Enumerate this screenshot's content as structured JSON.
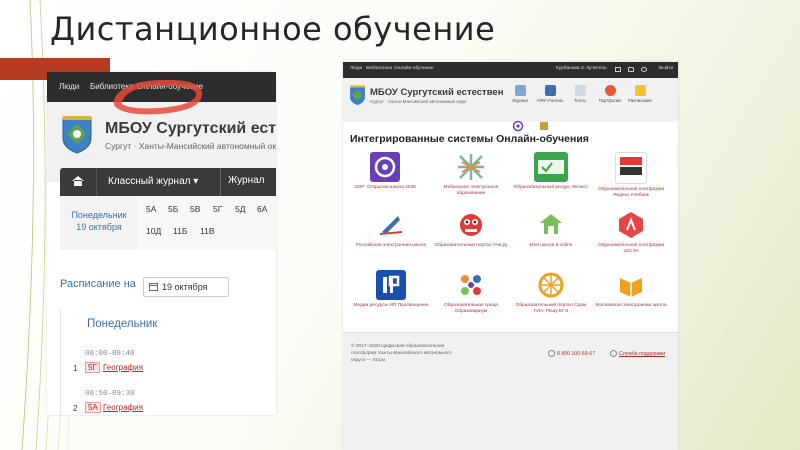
{
  "slide": {
    "title": "Дистанционное обучение"
  },
  "left_screenshot": {
    "nav": [
      "Люди",
      "Библиотека",
      "Онлайн-обучение"
    ],
    "school_title": "МБОУ Сургутский естественно",
    "school_subtitle": "Сургут · Ханты-Мансийский автономный округ",
    "journal_menu": "Классный журнал",
    "journal_next": "Журнал",
    "day": "Понедельник",
    "date": "19 октября",
    "classes_row1": [
      "5А",
      "5Б",
      "5В",
      "5Г",
      "5Д",
      "6А"
    ],
    "classes_row2": [
      "10Д",
      "11Б",
      "11В"
    ],
    "schedule_label": "Расписание на",
    "schedule_date": "19 октября",
    "card_day": "Понедельник",
    "lessons": [
      {
        "time": "08:00–08:40",
        "num": "1",
        "class": "5Г",
        "subject": "География"
      },
      {
        "time": "08:50–09:30",
        "num": "2",
        "class": "5А",
        "subject": "География"
      }
    ]
  },
  "right_screenshot": {
    "nav": [
      "Люди",
      "Библиотека",
      "Онлайн-обучение"
    ],
    "user": "Курбанова З. К.",
    "role": "учитель",
    "exit": "Выйти",
    "school_title": "МБОУ Сургутский естествен",
    "school_subtitle": "Сургут · Ханты-Мансийский автономный округ",
    "quick_items": [
      {
        "label": "Журнал",
        "color": "#7da7d9"
      },
      {
        "label": "АРМ Учитель",
        "color": "#3a6fae"
      },
      {
        "label": "Тесты",
        "color": "#cfd8e3"
      },
      {
        "label": "Портфолио",
        "color": "#e55a3a"
      },
      {
        "label": "Расписание",
        "color": "#f2c12e"
      }
    ],
    "section_title": "Интегрированные системы Онлайн-обучения",
    "tiles": [
      {
        "name": "ЭОР: Открытая школа 2035",
        "icon": "open-school-icon",
        "color": "#6a3fb5"
      },
      {
        "name": "Мобильное электронное образование",
        "icon": "mobile-education-icon",
        "color": "#e9eef2"
      },
      {
        "name": "Образовательный ресурс ЯКласс",
        "icon": "yaklass-icon",
        "color": "#3aa54a"
      },
      {
        "name": "Образовательная платформа Яндекс.Учебник",
        "icon": "yandex-textbook-icon",
        "color": "#ffffff"
      },
      {
        "name": "Российская электронная школа",
        "icon": "resh-icon",
        "color": "#e9eef2"
      },
      {
        "name": "Образовательный портал Учи.ру",
        "icon": "uchi-icon",
        "color": "#f2f2f2"
      },
      {
        "name": "Моя школа в online",
        "icon": "my-school-icon",
        "color": "#f2f2f2"
      },
      {
        "name": "Образовательная платформа LECTA",
        "icon": "lecta-icon",
        "color": "#e54545"
      },
      {
        "name": "Медиа ресурсы ИП Просвещение",
        "icon": "prosveshchenie-icon",
        "color": "#1b4fae"
      },
      {
        "name": "Образовательная среда Образовариум",
        "icon": "obrazovarium-icon",
        "color": "#f2f2f2"
      },
      {
        "name": "Образовательный портал Сдам ГИА: Решу ЕГЭ",
        "icon": "reshu-ege-icon",
        "color": "#f0a020"
      },
      {
        "name": "Московская электронная школа",
        "icon": "mesh-icon",
        "color": "#f2f2f2"
      }
    ],
    "footer_copy": "© 2017–2020 Цифровая образовательная платформа Ханты-Мансийского автономного округа — Югры",
    "phone": "8 800 100-58-67",
    "support": "Служба поддержки"
  }
}
